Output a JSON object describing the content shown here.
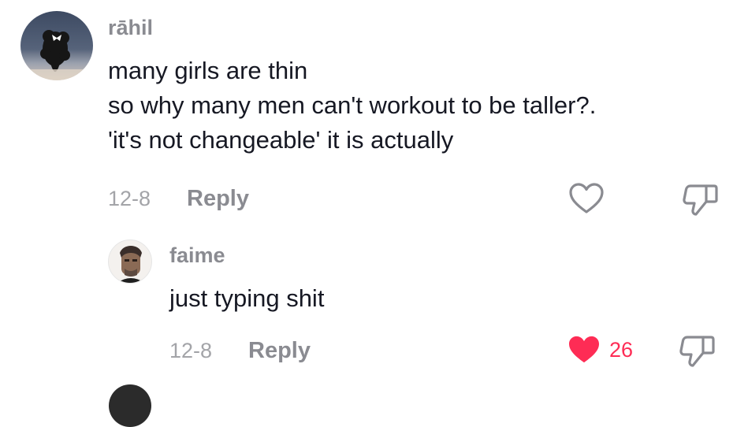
{
  "comments": [
    {
      "username": "rāhil",
      "lines": [
        "many girls are thin",
        "so why many men can't workout to be taller?.",
        "'it's not changeable' it is actually"
      ],
      "date": "12-8",
      "reply_label": "Reply",
      "liked": false,
      "like_count": ""
    },
    {
      "username": "faime",
      "lines": [
        "just typing shit"
      ],
      "date": "12-8",
      "reply_label": "Reply",
      "liked": true,
      "like_count": "26"
    }
  ],
  "icons": {
    "heart_outline": "heart-outline-icon",
    "heart_filled": "heart-filled-icon",
    "dislike": "thumbs-down-icon"
  },
  "colors": {
    "like_active": "#fe2c55",
    "muted_text": "#8a8b91",
    "body_text": "#161823"
  }
}
